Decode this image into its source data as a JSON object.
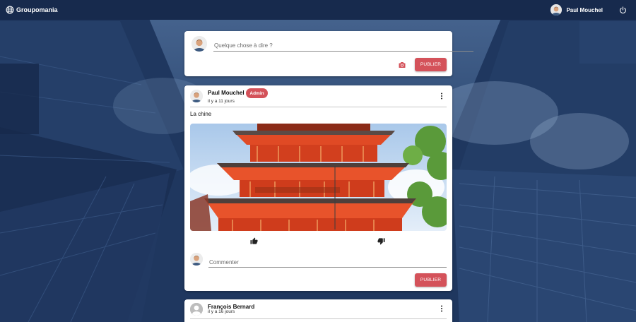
{
  "app": {
    "name": "Groupomania"
  },
  "user": {
    "name": "Paul Mouchel"
  },
  "composer": {
    "placeholder": "Quelque chose à dire ?",
    "publish_label": "PUBLIER"
  },
  "posts": [
    {
      "author": "Paul Mouchel",
      "badge": "Admin",
      "time": "il y a 11 jours",
      "text": "La chine",
      "comment_placeholder": "Commenter",
      "publish_label": "PUBLIER"
    },
    {
      "author": "François Bernard",
      "time": "il y a 16 jours"
    }
  ],
  "colors": {
    "navbar": "#172a4d",
    "accent": "#d4525a",
    "card": "#ffffff"
  }
}
